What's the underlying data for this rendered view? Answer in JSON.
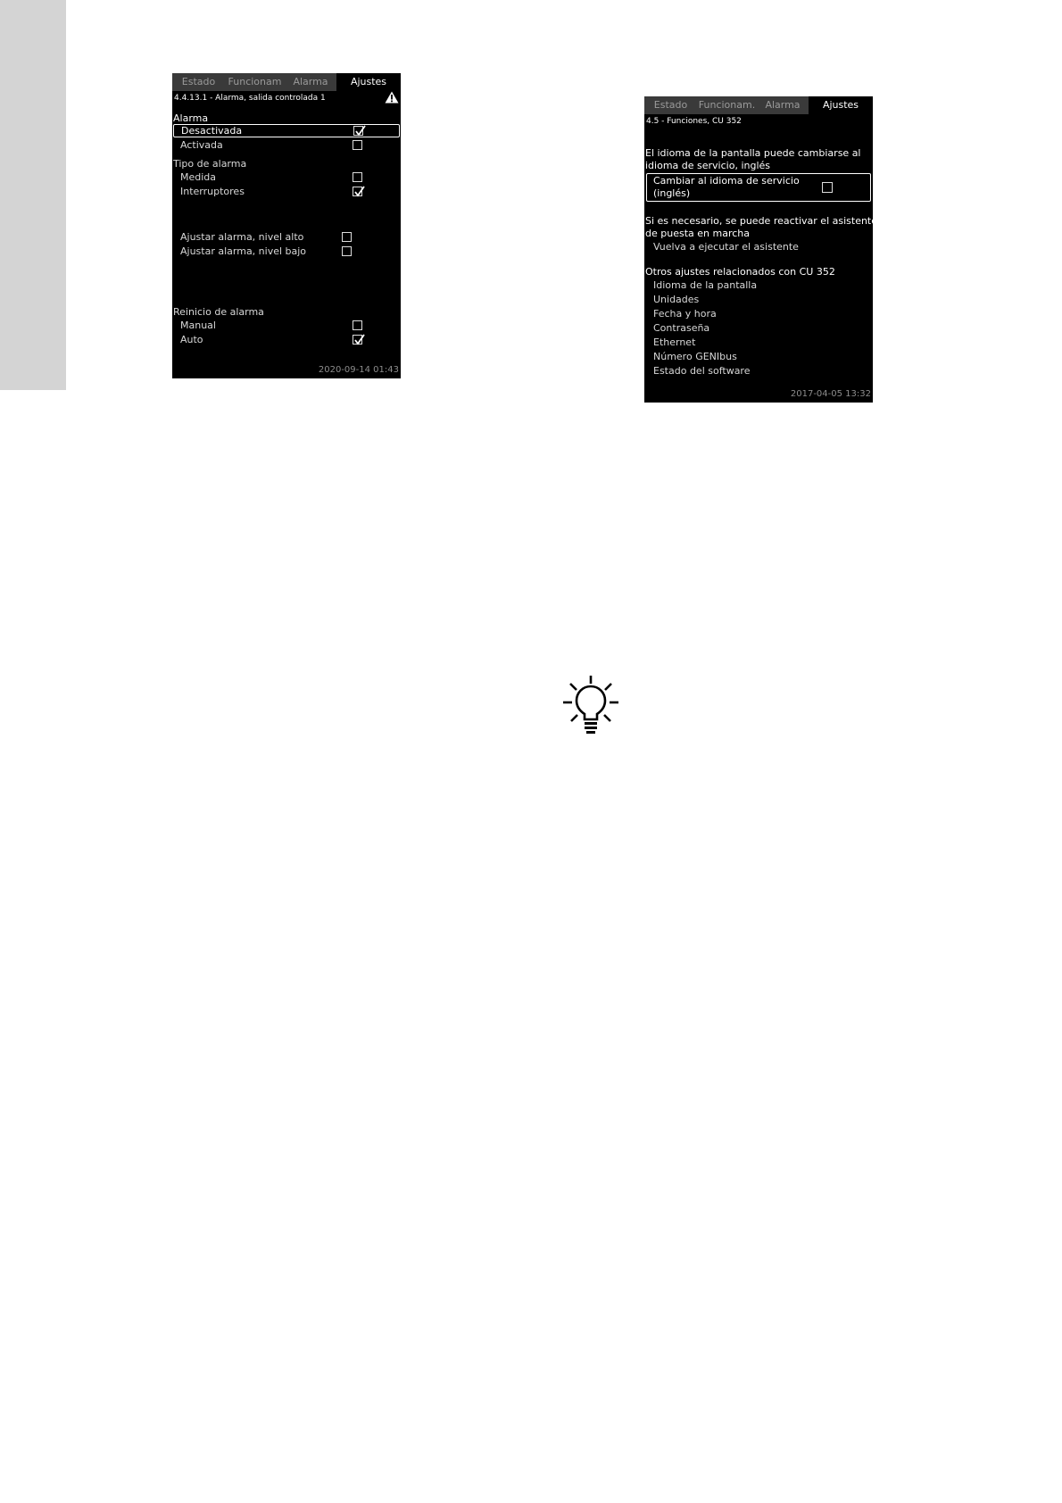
{
  "screen1": {
    "tabs": [
      "Estado",
      "Funcionam",
      "Alarma",
      "Ajustes"
    ],
    "active_tab": "Ajustes",
    "title": "4.4.13.1 - Alarma, salida controlada 1",
    "section_alarma": "Alarma",
    "opt_desactivada": "Desactivada",
    "opt_activada": "Activada",
    "section_tipo": "Tipo de alarma",
    "opt_medida": "Medida",
    "opt_interruptores": "Interruptores",
    "opt_nivel_alto": "Ajustar alarma, nivel alto",
    "opt_nivel_bajo": "Ajustar alarma, nivel bajo",
    "section_reinicio": "Reinicio de alarma",
    "opt_manual": "Manual",
    "opt_auto": "Auto",
    "timestamp": "2020-09-14  01:43"
  },
  "screen2": {
    "tabs": [
      "Estado",
      "Funcionam.",
      "Alarma",
      "Ajustes"
    ],
    "active_tab": "Ajustes",
    "title": "4.5 - Funciones, CU 352",
    "info_line1": "El idioma de la pantalla puede cambiarse al",
    "info_line2": "idioma de servicio, inglés",
    "opt_cambiar_line1": "Cambiar al idioma de servicio",
    "opt_cambiar_line2": "(inglés)",
    "reactivar_line1": "Si es necesario, se puede reactivar el asistente",
    "reactivar_line2": "de puesta en marcha",
    "opt_vuelva": "Vuelva a ejecutar el asistente",
    "section_otros": "Otros ajustes relacionados con CU 352",
    "items": [
      "Idioma de la pantalla",
      "Unidades",
      "Fecha y hora",
      "Contraseña",
      "Ethernet",
      "Número GENIbus",
      "Estado del software"
    ],
    "timestamp": "2017-04-05  13:32"
  },
  "icons": {
    "warning": "warning-triangle-icon",
    "checkmark": "checkmark-icon",
    "tip": "lightbulb-icon"
  },
  "colors": {
    "screen_bg": "#000000",
    "tab_inactive_bg": "#3a3a3a",
    "side_strip": "#d4d4d4"
  }
}
